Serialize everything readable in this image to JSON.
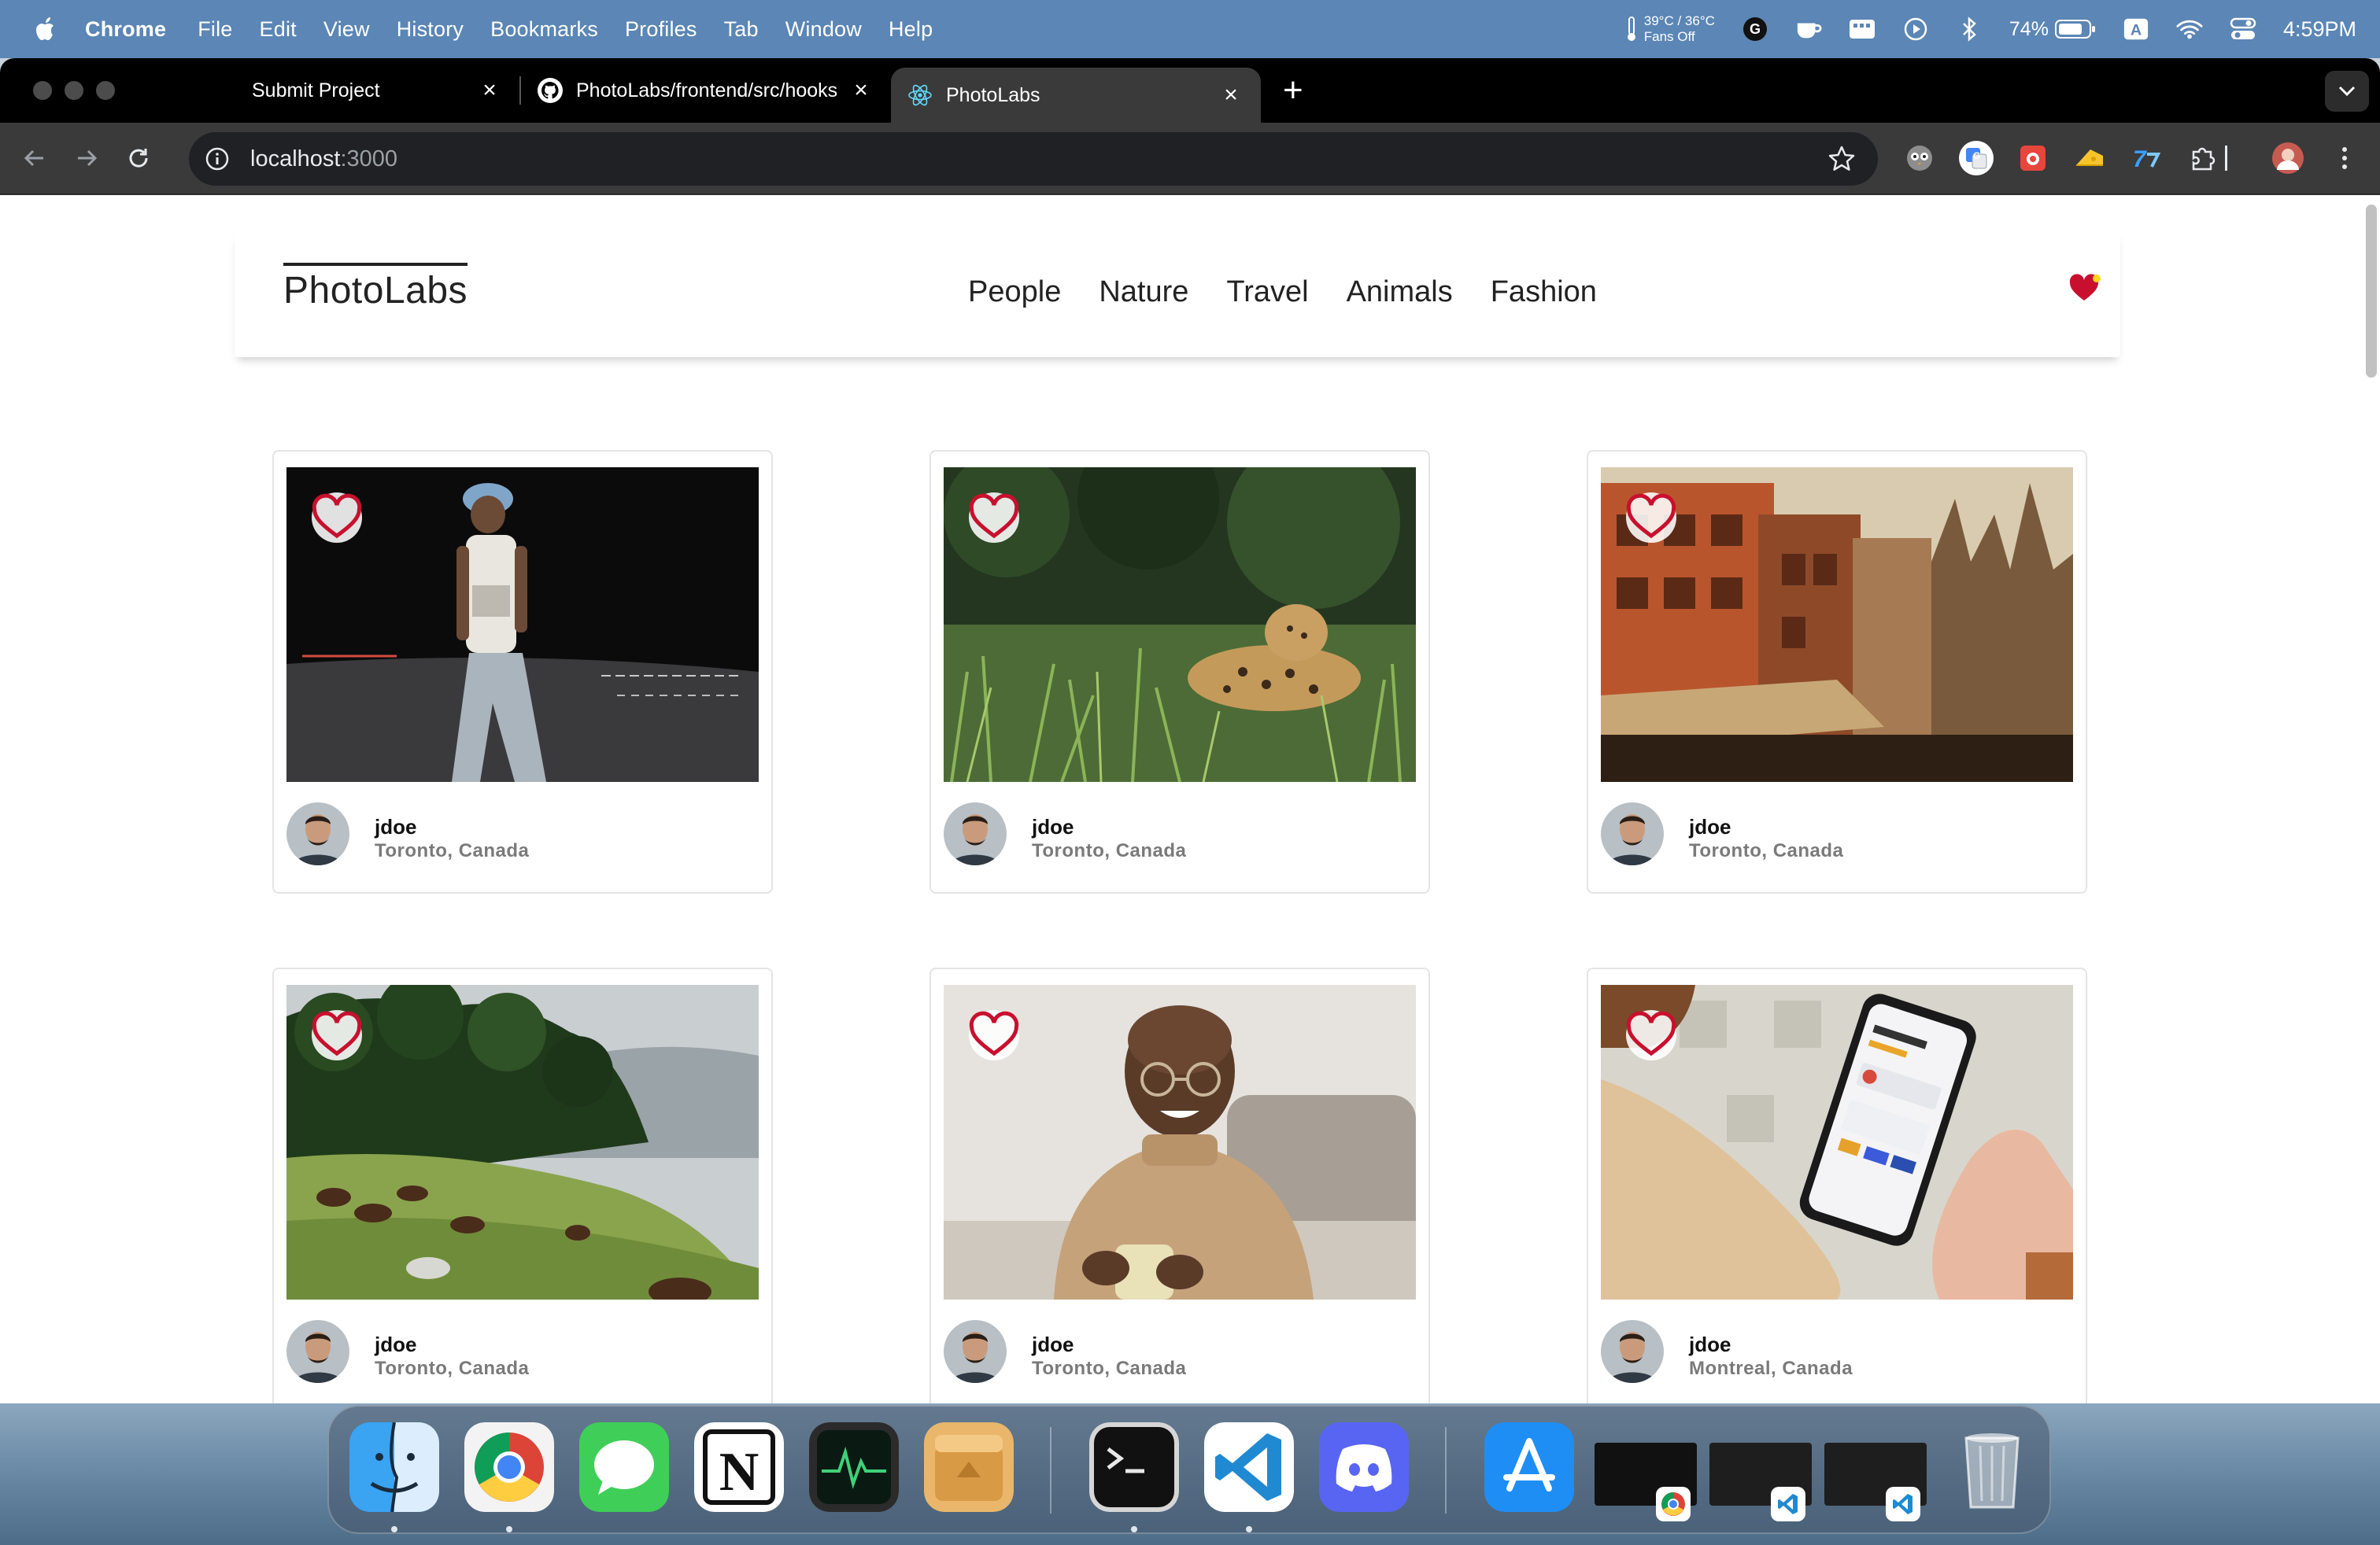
{
  "menubar": {
    "app_name": "Chrome",
    "menus": [
      "File",
      "Edit",
      "View",
      "History",
      "Bookmarks",
      "Profiles",
      "Tab",
      "Window",
      "Help"
    ],
    "temp_line1": "39°C / 36°C",
    "temp_line2": "Fans Off",
    "keyboard_label": "A",
    "battery_percent": "74%",
    "clock": "4:59PM"
  },
  "browser": {
    "tabs": [
      {
        "title": "Submit Project",
        "icon": "none"
      },
      {
        "title": "PhotoLabs/frontend/src/hooks",
        "icon": "github-icon"
      },
      {
        "title": "PhotoLabs",
        "icon": "react-icon",
        "active": true
      }
    ],
    "url_host": "localhost",
    "url_port": ":3000"
  },
  "app": {
    "logo": "PhotoLabs",
    "topics": [
      "People",
      "Nature",
      "Travel",
      "Animals",
      "Fashion"
    ],
    "colors": {
      "heart": "#c8102e",
      "fav_dot": "#ffd51d"
    },
    "photos": [
      {
        "username": "jdoe",
        "location": "Toronto, Canada",
        "scene": "person-night-street"
      },
      {
        "username": "jdoe",
        "location": "Toronto, Canada",
        "scene": "jaguar-grass"
      },
      {
        "username": "jdoe",
        "location": "Toronto, Canada",
        "scene": "old-city-buildings"
      },
      {
        "username": "jdoe",
        "location": "Toronto, Canada",
        "scene": "horses-hillside"
      },
      {
        "username": "jdoe",
        "location": "Toronto, Canada",
        "scene": "smiling-man-mug"
      },
      {
        "username": "jdoe",
        "location": "Montreal, Canada",
        "scene": "hand-holding-phone"
      }
    ]
  },
  "dock": {
    "apps": [
      "finder-icon",
      "chrome-icon",
      "messages-icon",
      "notion-icon",
      "activity-monitor-icon",
      "archive-utility-icon",
      "terminal-icon",
      "vscode-icon",
      "discord-icon",
      "app-store-icon",
      "trash-icon"
    ]
  }
}
